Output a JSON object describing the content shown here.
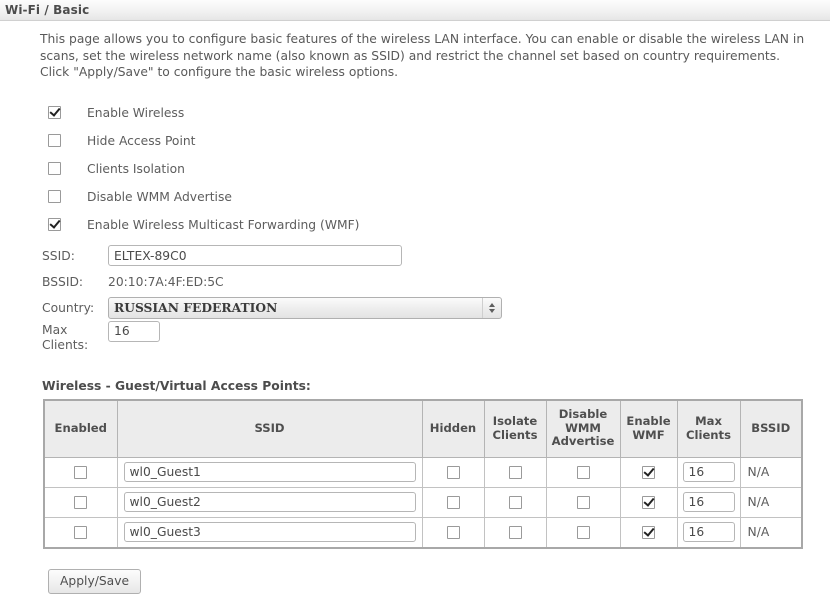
{
  "header": {
    "title": "Wi-Fi / Basic"
  },
  "intro": {
    "text": "This page allows you to configure basic features of the wireless LAN interface. You can enable or disable the wireless LAN in\nscans, set the wireless network name (also known as SSID) and restrict the channel set based on country requirements.\nClick \"Apply/Save\" to configure the basic wireless options."
  },
  "checkboxes": [
    {
      "label": "Enable Wireless",
      "checked": true
    },
    {
      "label": "Hide Access Point",
      "checked": false
    },
    {
      "label": "Clients Isolation",
      "checked": false
    },
    {
      "label": "Disable WMM Advertise",
      "checked": false
    },
    {
      "label": "Enable Wireless Multicast Forwarding (WMF)",
      "checked": true
    }
  ],
  "fields": {
    "ssid": {
      "label": "SSID:",
      "value": "ELTEX-89C0"
    },
    "bssid": {
      "label": "BSSID:",
      "value": "20:10:7A:4F:ED:5C"
    },
    "country": {
      "label": "Country:",
      "value": "RUSSIAN FEDERATION"
    },
    "max_clients": {
      "label_line1": "Max",
      "label_line2": "Clients:",
      "value": "16"
    }
  },
  "table": {
    "title": "Wireless - Guest/Virtual Access Points:",
    "columns": [
      "Enabled",
      "SSID",
      "Hidden",
      "Isolate\nClients",
      "Disable\nWMM\nAdvertise",
      "Enable\nWMF",
      "Max\nClients",
      "BSSID"
    ],
    "rows": [
      {
        "enabled": false,
        "ssid": "wl0_Guest1",
        "hidden": false,
        "isolate_clients": false,
        "disable_wmm_advertise": false,
        "enable_wmf": true,
        "max_clients": "16",
        "bssid": "N/A"
      },
      {
        "enabled": false,
        "ssid": "wl0_Guest2",
        "hidden": false,
        "isolate_clients": false,
        "disable_wmm_advertise": false,
        "enable_wmf": true,
        "max_clients": "16",
        "bssid": "N/A"
      },
      {
        "enabled": false,
        "ssid": "wl0_Guest3",
        "hidden": false,
        "isolate_clients": false,
        "disable_wmm_advertise": false,
        "enable_wmf": true,
        "max_clients": "16",
        "bssid": "N/A"
      }
    ]
  },
  "actions": {
    "apply_save": "Apply/Save"
  },
  "colors": {
    "header_border": "#d0d0d0",
    "text": "#5a5a5a",
    "table_header_bg": "#ececec",
    "table_border": "#a8a8a8"
  }
}
